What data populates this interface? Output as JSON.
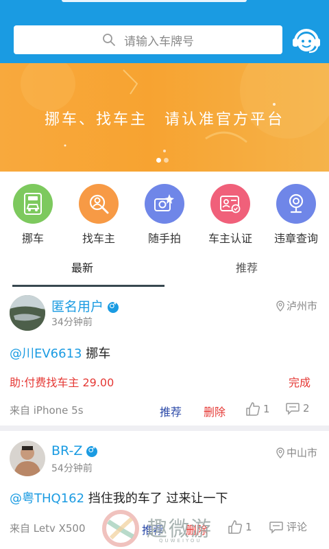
{
  "search": {
    "placeholder": "请输入车牌号",
    "icon": "search-icon"
  },
  "header": {
    "service_icon": "customer-service-icon"
  },
  "banner": {
    "text": "挪车、找车主　请认准官方平台",
    "dots": 2,
    "active_dot": 0
  },
  "quick_actions": [
    {
      "label": "挪车",
      "icon": "move-car-icon",
      "color": "#7dc95e"
    },
    {
      "label": "找车主",
      "icon": "find-owner-icon",
      "color": "#f79a45"
    },
    {
      "label": "随手拍",
      "icon": "snapshot-camera-icon",
      "color": "#6f86e8"
    },
    {
      "label": "车主认证",
      "icon": "owner-certify-icon",
      "color": "#f0607a"
    },
    {
      "label": "违章查询",
      "icon": "violation-query-icon",
      "color": "#6f86e8"
    }
  ],
  "tabs": [
    {
      "label": "最新",
      "active": true
    },
    {
      "label": "推荐",
      "active": false
    }
  ],
  "posts": [
    {
      "username": "匿名用户",
      "time": "34分钟前",
      "location": "泸州市",
      "plate": "@川EV6613",
      "text": "挪车",
      "reward": "助:付费找车主 29.00",
      "status": "完成",
      "device": "来自  iPhone 5s",
      "recommend_label": "推荐",
      "delete_label": "删除",
      "likes": "1",
      "comments": "2"
    },
    {
      "username": "BR-Z",
      "time": "54分钟前",
      "location": "中山市",
      "plate": "@粤THQ162",
      "text": "挡住我的车了 过来让一下",
      "device": "来自  Letv X500",
      "recommend_label": "推荐",
      "delete_label": "删除",
      "likes": "1",
      "comments": "评论"
    }
  ],
  "watermark": {
    "text": "趣微游",
    "sub": "QUWEIYOU"
  }
}
